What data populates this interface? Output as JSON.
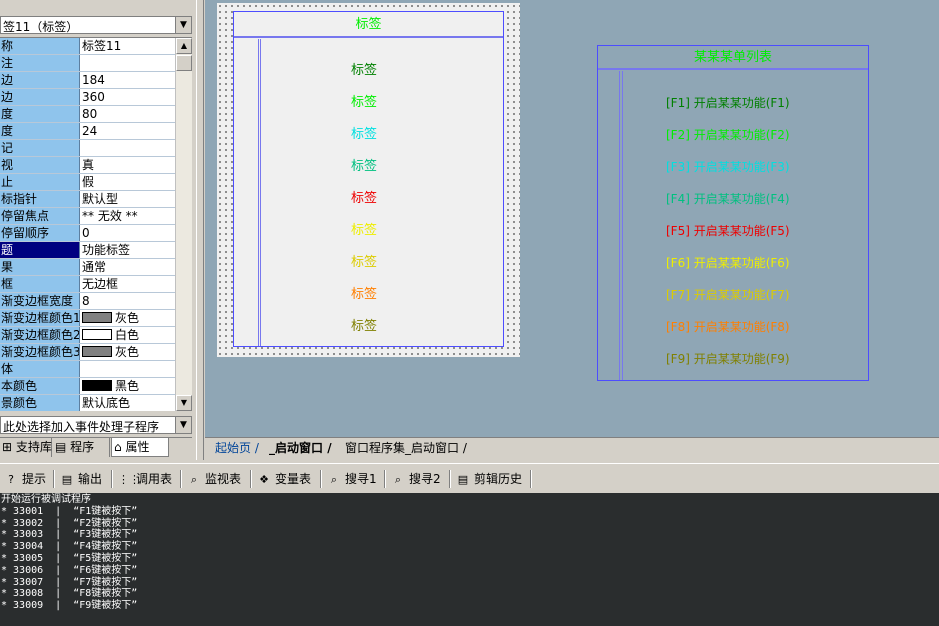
{
  "property_panel": {
    "object_selector": "签11（标签）",
    "rows": [
      {
        "name": "称",
        "value": "标签11"
      },
      {
        "name": "注",
        "value": ""
      },
      {
        "name": "边",
        "value": "184"
      },
      {
        "name": "边",
        "value": "360"
      },
      {
        "name": "度",
        "value": "80"
      },
      {
        "name": "度",
        "value": "24"
      },
      {
        "name": "记",
        "value": ""
      },
      {
        "name": "视",
        "value": "真"
      },
      {
        "name": "止",
        "value": "假"
      },
      {
        "name": "标指针",
        "value": "默认型"
      },
      {
        "name": "停留焦点",
        "value": "** 无效 **"
      },
      {
        "name": "停留顺序",
        "value": "0"
      },
      {
        "name": "题",
        "value": "功能标签",
        "selected": true
      },
      {
        "name": "果",
        "value": "通常"
      },
      {
        "name": "框",
        "value": "无边框"
      },
      {
        "name": "渐变边框宽度",
        "value": "8"
      },
      {
        "name": "渐变边框颜色1",
        "value": "灰色",
        "swatch": "#808080"
      },
      {
        "name": "渐变边框颜色2",
        "value": "白色",
        "swatch": "#ffffff"
      },
      {
        "name": "渐变边框颜色3",
        "value": "灰色",
        "swatch": "#808080"
      },
      {
        "name": "体",
        "value": ""
      },
      {
        "name": "本颜色",
        "value": "黑色",
        "swatch": "#000000"
      },
      {
        "name": "景颜色",
        "value": "默认底色"
      }
    ],
    "event_selector": "此处选择加入事件处理子程序",
    "tabs": [
      {
        "label": "支持库",
        "icon": "library-icon"
      },
      {
        "label": "程序",
        "icon": "program-icon"
      },
      {
        "label": "属性",
        "icon": "property-icon"
      }
    ]
  },
  "designer": {
    "form": {
      "title": "标签",
      "labels": [
        {
          "text": "标签",
          "color": "#008000"
        },
        {
          "text": "标签",
          "color": "#00ee00"
        },
        {
          "text": "标签",
          "color": "#00e0e0"
        },
        {
          "text": "标签",
          "color": "#00c080"
        },
        {
          "text": "标签",
          "color": "#ee0000"
        },
        {
          "text": "标签",
          "color": "#eeee00"
        },
        {
          "text": "标签",
          "color": "#dccc00"
        },
        {
          "text": "标签",
          "color": "#ff7f00"
        },
        {
          "text": "标签",
          "color": "#808000"
        }
      ]
    },
    "list": {
      "title": "某某某单列表",
      "items": [
        {
          "text": "[F1] 开启某某功能(F1)",
          "color": "#008000"
        },
        {
          "text": "[F2] 开启某某功能(F2)",
          "color": "#00ee00"
        },
        {
          "text": "[F3] 开启某某功能(F3)",
          "color": "#00e0e0"
        },
        {
          "text": "[F4] 开启某某功能(F4)",
          "color": "#00c080"
        },
        {
          "text": "[F5] 开启某某功能(F5)",
          "color": "#ee0000"
        },
        {
          "text": "[F6] 开启某某功能(F6)",
          "color": "#eeee00"
        },
        {
          "text": "[F7] 开启某某功能(F7)",
          "color": "#dccc00"
        },
        {
          "text": "[F8] 开启某某功能(F8)",
          "color": "#ff7f00"
        },
        {
          "text": "[F9] 开启某某功能(F9)",
          "color": "#808000"
        }
      ]
    }
  },
  "doc_tabs": [
    {
      "label": "起始页"
    },
    {
      "label": "_启动窗口",
      "active": true
    },
    {
      "label": "窗口程序集_启动窗口"
    }
  ],
  "tool_tabs": [
    {
      "label": "提示",
      "icon": "hint-icon"
    },
    {
      "label": "输出",
      "icon": "output-icon"
    },
    {
      "label": "调用表",
      "icon": "call-table-icon"
    },
    {
      "label": "监视表",
      "icon": "watch-icon"
    },
    {
      "label": "变量表",
      "icon": "variable-icon"
    },
    {
      "label": "搜寻1",
      "icon": "search1-icon"
    },
    {
      "label": "搜寻2",
      "icon": "search2-icon"
    },
    {
      "label": "剪辑历史",
      "icon": "clip-history-icon"
    }
  ],
  "output": {
    "lines": [
      "开始运行被调试程序",
      "* 33001  |  “F1键被按下”",
      "* 33002  |  “F2键被按下”",
      "* 33003  |  “F3键被按下”",
      "* 33004  |  “F4键被按下”",
      "* 33005  |  “F5键被按下”",
      "* 33006  |  “F6键被按下”",
      "* 33007  |  “F7键被按下”",
      "* 33008  |  “F8键被按下”",
      "* 33009  |  “F9键被按下”"
    ]
  }
}
